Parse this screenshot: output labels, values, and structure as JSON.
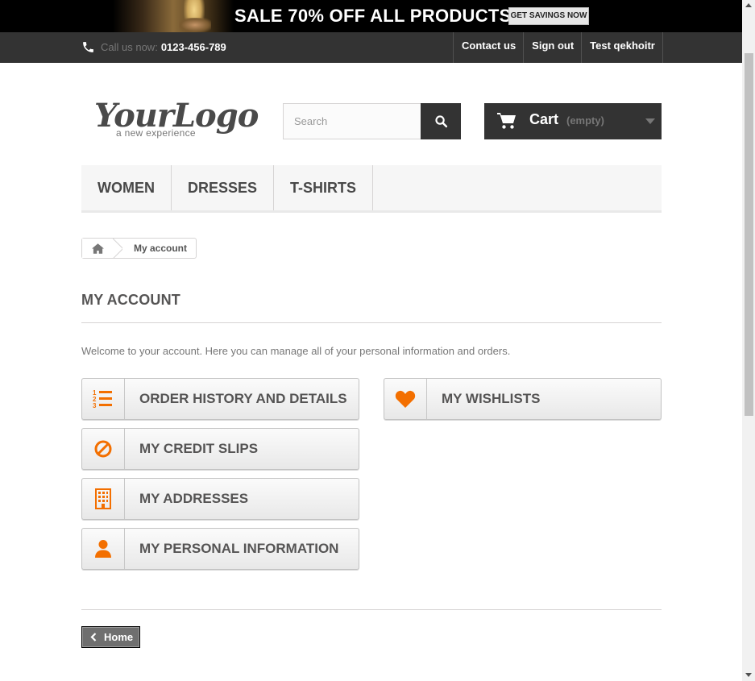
{
  "banner": {
    "text": "SALE 70% OFF ALL PRODUCTS",
    "button": "GET SAVINGS NOW"
  },
  "topbar": {
    "call_label": "Call us now:",
    "phone": "0123-456-789",
    "links": [
      "Contact us",
      "Sign out",
      "Test qekhoitr"
    ]
  },
  "header": {
    "logo_main": "YourLogo",
    "logo_sub": "a new experience",
    "search_placeholder": "Search",
    "cart_label": "Cart",
    "cart_status": "(empty)"
  },
  "menu": [
    "WOMEN",
    "DRESSES",
    "T-SHIRTS"
  ],
  "breadcrumb": {
    "current": "My account"
  },
  "page": {
    "title": "MY ACCOUNT",
    "welcome": "Welcome to your account. Here you can manage all of your personal information and orders."
  },
  "account_links": [
    {
      "label": "ORDER HISTORY AND DETAILS",
      "icon": "ordered-list-icon"
    },
    {
      "label": "MY CREDIT SLIPS",
      "icon": "ban-icon"
    },
    {
      "label": "MY ADDRESSES",
      "icon": "building-icon"
    },
    {
      "label": "MY PERSONAL INFORMATION",
      "icon": "user-icon"
    },
    {
      "label": "MY WISHLISTS",
      "icon": "heart-icon"
    }
  ],
  "footer_nav": {
    "home_label": "Home"
  },
  "colors": {
    "accent": "#f36f00",
    "dark": "#333333",
    "text": "#555454"
  }
}
